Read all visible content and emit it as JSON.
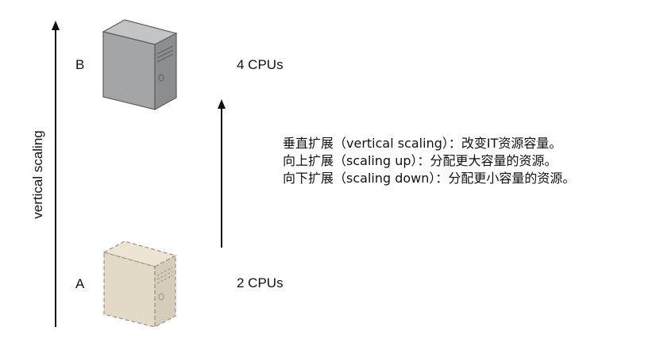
{
  "axis": {
    "label": "vertical scaling"
  },
  "servers": {
    "a": {
      "label": "A",
      "cpus": "2 CPUs",
      "fill": "#e6dccb",
      "stroke": "#9a9189",
      "style": "dashed"
    },
    "b": {
      "label": "B",
      "cpus": "4 CPUs",
      "fill": "#a9aaac",
      "stroke": "#5d5e60",
      "style": "solid"
    }
  },
  "notes": [
    "垂直扩展（vertical scaling）：改变IT资源容量。",
    "向上扩展（scaling up）：分配更大容量的资源。",
    "向下扩展（scaling down）：分配更小容量的资源。"
  ]
}
